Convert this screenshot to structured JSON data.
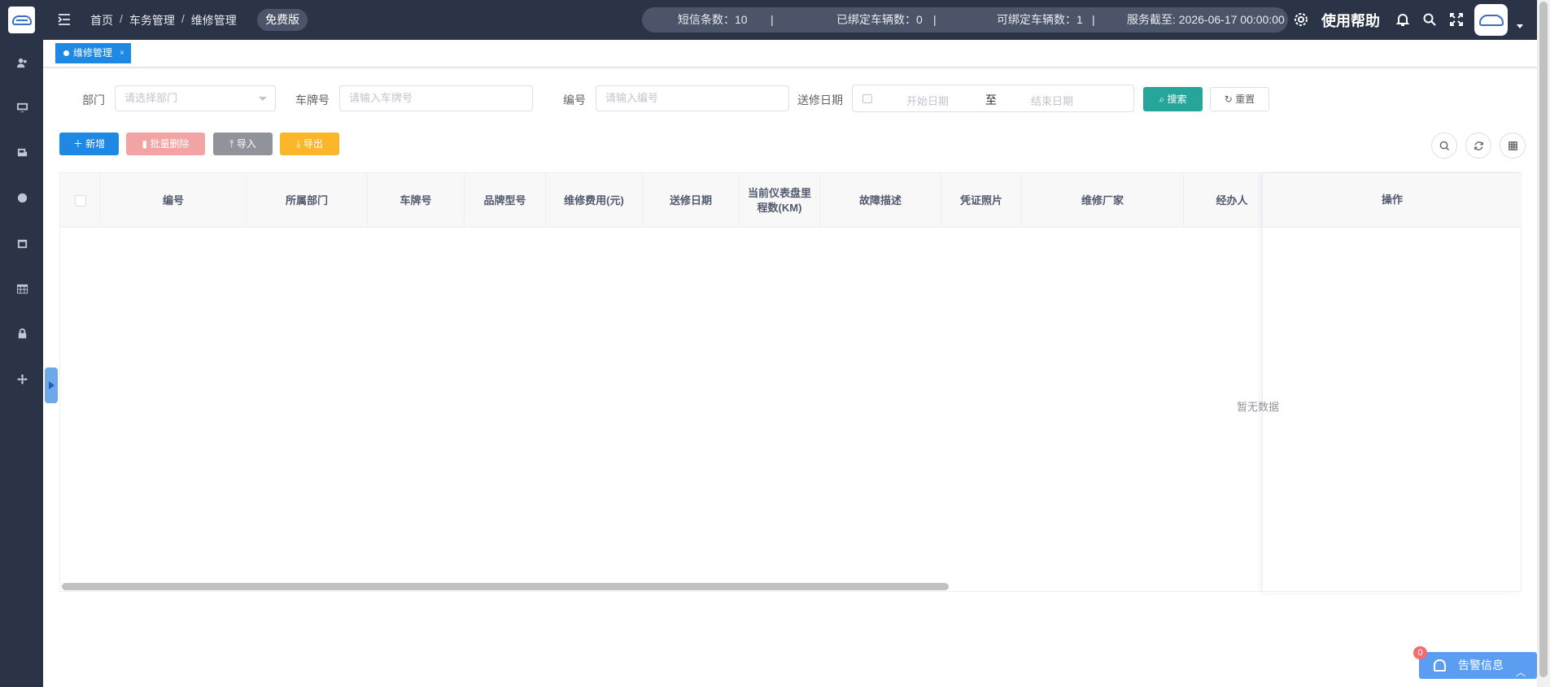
{
  "header": {
    "breadcrumb": [
      "首页",
      "车务管理",
      "维修管理"
    ],
    "badge": "免费版",
    "status": {
      "sms": "短信条数：10",
      "bound": "已绑定车辆数：0",
      "bindable": "可绑定车辆数：1",
      "service": "服务截至: 2026-06-17 00:00:00"
    },
    "separator": "|",
    "help": "使用帮助"
  },
  "tab": {
    "label": "维修管理",
    "close": "×"
  },
  "filters": {
    "dept_label": "部门",
    "dept_placeholder": "请选择部门",
    "plate_label": "车牌号",
    "plate_placeholder": "请输入车牌号",
    "code_label": "编号",
    "code_placeholder": "请输入编号",
    "date_label": "送修日期",
    "start_placeholder": "开始日期",
    "to": "至",
    "end_placeholder": "结束日期",
    "search": "搜索",
    "reset": "重置"
  },
  "toolbar": {
    "add": "新增",
    "batch_delete": "批量删除",
    "import": "导入",
    "export": "导出"
  },
  "table": {
    "columns": [
      "编号",
      "所属部门",
      "车牌号",
      "品牌型号",
      "维修费用(元)",
      "送修日期",
      "当前仪表盘里程数(KM)",
      "故障描述",
      "凭证照片",
      "维修厂家",
      "经办人",
      "操作"
    ],
    "empty": "暂无数据"
  },
  "alarm": {
    "label": "告警信息",
    "count": "0"
  }
}
